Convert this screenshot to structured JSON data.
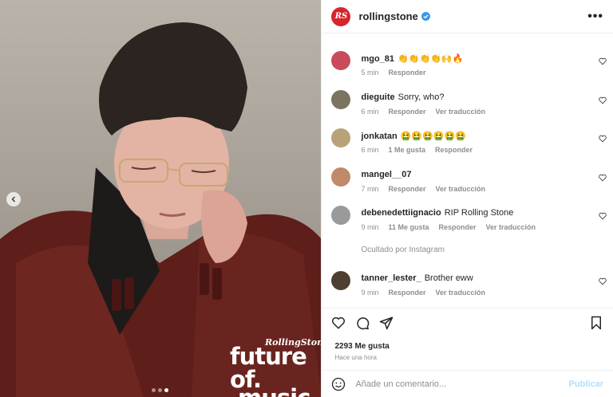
{
  "post": {
    "account": "rollingstone",
    "avatar_initials": "RS",
    "more_label": "•••",
    "brand_small": "RollingStone",
    "brand_line1": "future of.",
    "brand_line2": "music"
  },
  "comments": [
    {
      "user": "mgo_81",
      "text": "👏👏👏👏🙌🔥",
      "time": "5 min",
      "likes": "",
      "reply": "Responder",
      "translate": "",
      "avatar_color": "#c94a5a"
    },
    {
      "user": "dieguite",
      "text": "Sorry, who?",
      "time": "6 min",
      "likes": "",
      "reply": "Responder",
      "translate": "Ver traducción",
      "avatar_color": "#7a7460"
    },
    {
      "user": "jonkatan",
      "text": "🤮🤮🤮🤮🤮🤮",
      "time": "6 min",
      "likes": "1 Me gusta",
      "reply": "Responder",
      "translate": "",
      "avatar_color": "#b9a27a"
    },
    {
      "user": "mangel__07",
      "text": "",
      "time": "7 min",
      "likes": "",
      "reply": "Responder",
      "translate": "Ver traducción",
      "avatar_color": "#c08a6a"
    },
    {
      "user": "debenedettiignacio",
      "text": "RIP Rolling Stone",
      "time": "9 min",
      "likes": "11 Me gusta",
      "reply": "Responder",
      "translate": "Ver traducción",
      "avatar_color": "#9a9a9a"
    },
    {
      "user": "tanner_lester_",
      "text": "Brother eww",
      "time": "9 min",
      "likes": "",
      "reply": "Responder",
      "translate": "Ver traducción",
      "avatar_color": "#4d4030"
    }
  ],
  "hidden_note": "Ocultado por Instagram",
  "likes_count": "2293 Me gusta",
  "posted_time": "Hace una hora",
  "comment_box": {
    "placeholder": "Añade un comentario...",
    "post_label": "Publicar"
  }
}
